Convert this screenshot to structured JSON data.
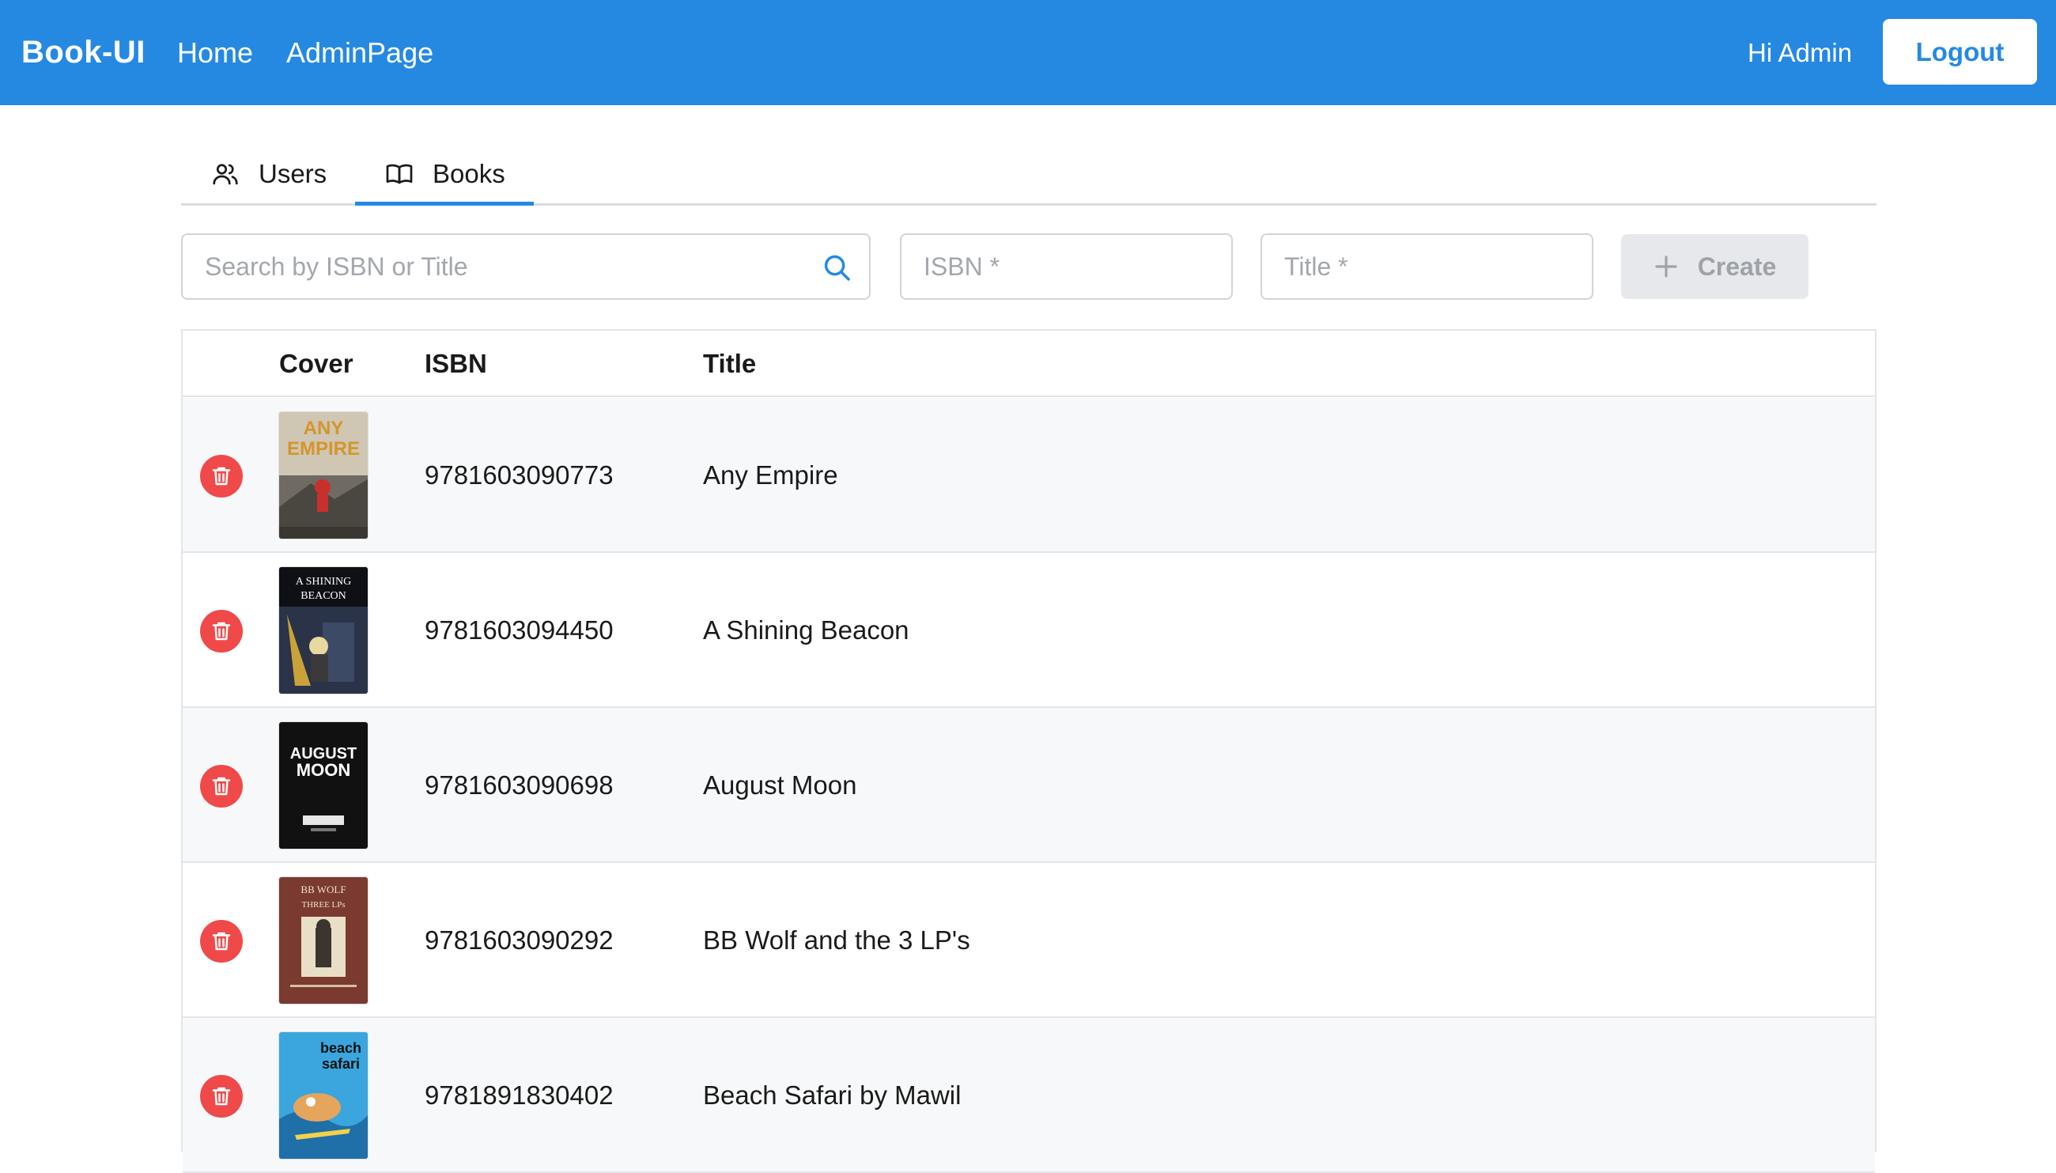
{
  "header": {
    "brand": "Book-UI",
    "nav": [
      "Home",
      "AdminPage"
    ],
    "greeting": "Hi Admin",
    "logout_label": "Logout"
  },
  "tabs": [
    {
      "label": "Users",
      "icon": "users-icon",
      "active": false
    },
    {
      "label": "Books",
      "icon": "book-open-icon",
      "active": true
    }
  ],
  "controls": {
    "search_placeholder": "Search by ISBN or Title",
    "isbn_placeholder": "ISBN *",
    "title_placeholder": "Title *",
    "create_label": "Create"
  },
  "table": {
    "columns": [
      "Cover",
      "ISBN",
      "Title"
    ],
    "rows": [
      {
        "isbn": "9781603090773",
        "title": "Any Empire",
        "cover_text": [
          "ANY",
          "EMPIRE"
        ],
        "cover_bg": "#cfc6b4"
      },
      {
        "isbn": "9781603094450",
        "title": "A Shining Beacon",
        "cover_text": [
          "A SHINING",
          "BEACON"
        ],
        "cover_bg": "#2a3348"
      },
      {
        "isbn": "9781603090698",
        "title": "August Moon",
        "cover_text": [
          "AUGUST",
          "MOON"
        ],
        "cover_bg": "#111111"
      },
      {
        "isbn": "9781603090292",
        "title": "BB Wolf and the 3 LP's",
        "cover_text": [
          "BB WOLF",
          "THREE LPs"
        ],
        "cover_bg": "#7a3a30"
      },
      {
        "isbn": "9781891830402",
        "title": "Beach Safari by Mawil",
        "cover_text": [
          "beach",
          "safari"
        ],
        "cover_bg": "#3aa6dd"
      }
    ]
  },
  "colors": {
    "primary": "#2589e2",
    "danger": "#f04949",
    "row_alt": "#f7f8f9"
  }
}
